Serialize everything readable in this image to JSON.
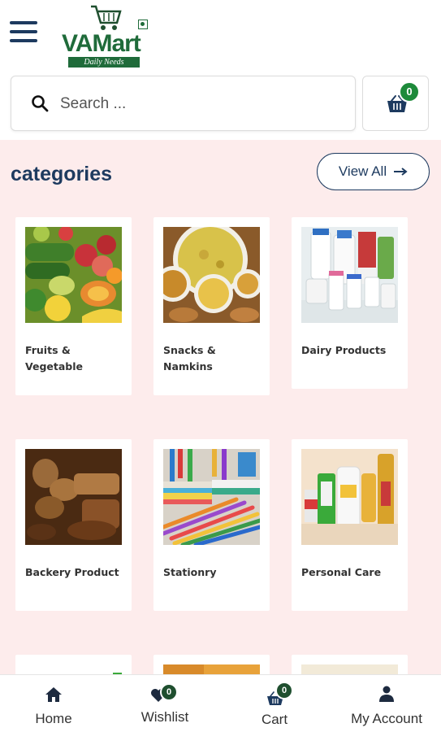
{
  "header": {
    "menu_icon": "hamburger-icon",
    "logo": {
      "brand": "VAMart",
      "tagline": "Daily Needs"
    }
  },
  "search": {
    "placeholder": "Search ...",
    "icon": "search-icon"
  },
  "cart_button": {
    "icon": "basket-icon",
    "count": "0"
  },
  "categories": {
    "title": "categories",
    "view_all_label": "View All",
    "items": [
      {
        "label": "Fruits & Vegetable",
        "image": "fruits-vegetables-photo"
      },
      {
        "label": "Snacks & Namkins",
        "image": "snacks-photo"
      },
      {
        "label": "Dairy Products",
        "image": "dairy-photo"
      },
      {
        "label": "Backery Product",
        "image": "bakery-photo"
      },
      {
        "label": "Stationry",
        "image": "stationery-photo"
      },
      {
        "label": "Personal Care",
        "image": "personal-care-photo"
      }
    ]
  },
  "bottom_nav": {
    "home": {
      "label": "Home",
      "icon": "home-icon"
    },
    "wishlist": {
      "label": "Wishlist",
      "icon": "heart-icon",
      "count": "0"
    },
    "cart": {
      "label": "Cart",
      "icon": "basket-icon",
      "count": "0"
    },
    "account": {
      "label": "My Account",
      "icon": "user-icon"
    }
  },
  "colors": {
    "primary": "#1d3a5f",
    "brand_green": "#1f6b3a",
    "badge_green": "#1d8a3a",
    "section_bg": "#fdecec"
  }
}
